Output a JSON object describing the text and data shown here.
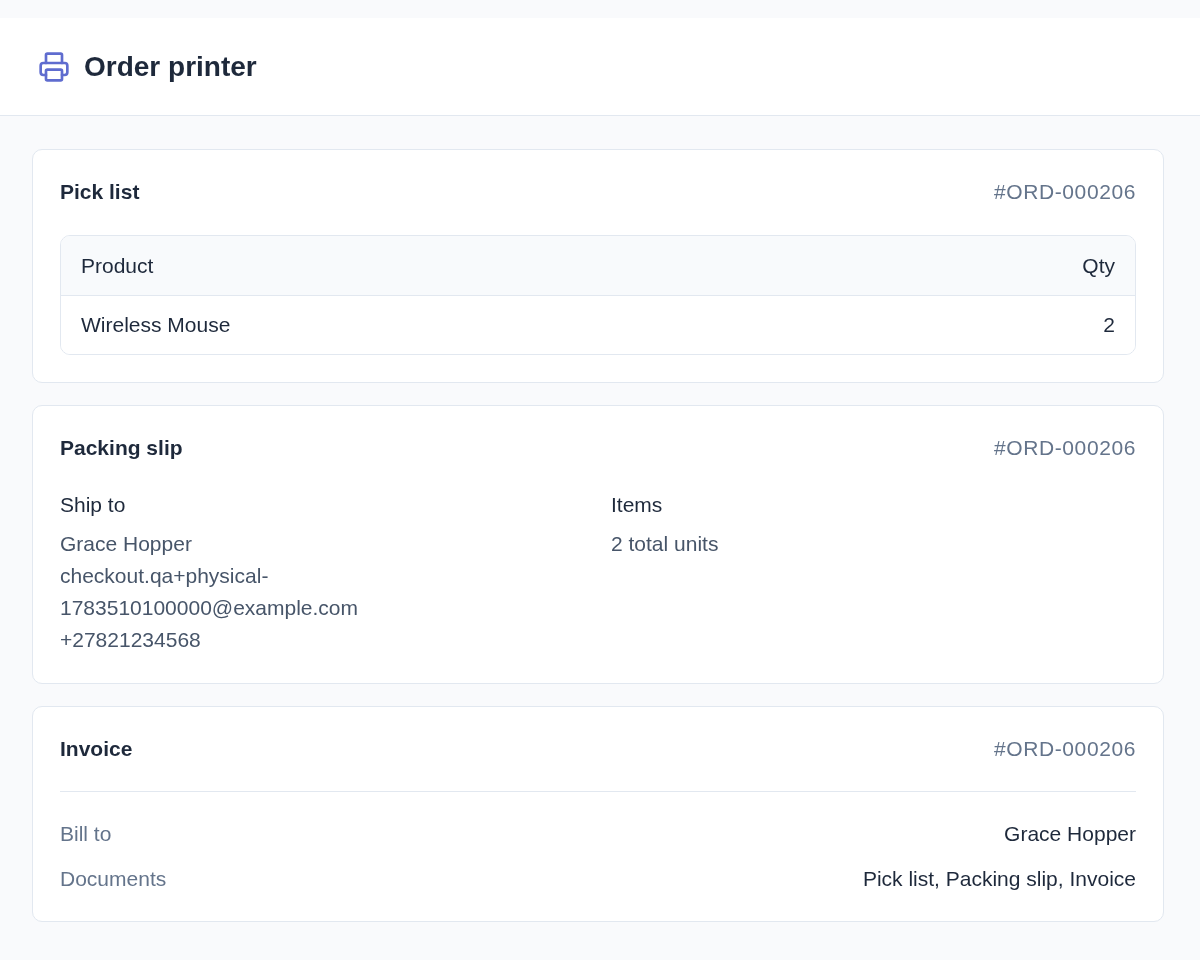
{
  "header": {
    "title": "Order printer"
  },
  "sections": [
    {
      "kind": "table",
      "title": "Pick list",
      "order_number": "#ORD-000206",
      "table": {
        "columns": [
          "Product",
          "Qty"
        ],
        "rows": [
          [
            "Wireless Mouse",
            "2"
          ]
        ]
      }
    },
    {
      "kind": "columns",
      "title": "Packing slip",
      "order_number": "#ORD-000206",
      "columns": [
        {
          "label": "Ship to",
          "lines": [
            "Grace Hopper",
            "checkout.qa+physical-1783510100000@example.com",
            "+27821234568"
          ]
        },
        {
          "label": "Items",
          "lines": [
            "2 total units"
          ]
        }
      ]
    },
    {
      "kind": "summary",
      "title": "Invoice",
      "order_number": "#ORD-000206",
      "rows": [
        {
          "label": "Bill to",
          "value": "Grace Hopper"
        },
        {
          "label": "Documents",
          "value": "Pick list, Packing slip, Invoice"
        }
      ]
    }
  ]
}
